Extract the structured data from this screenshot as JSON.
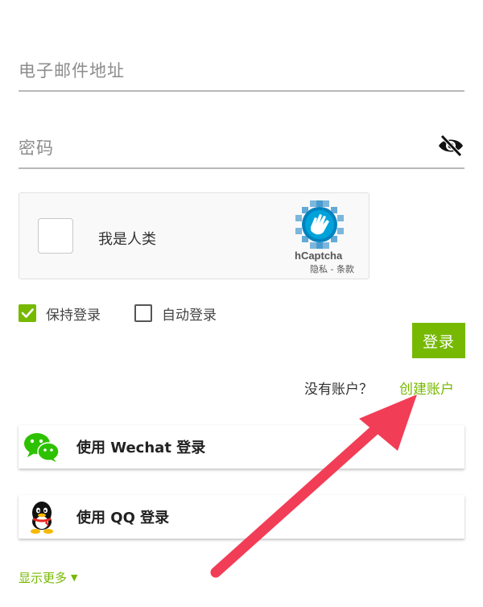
{
  "form": {
    "email_placeholder": "电子邮件地址",
    "password_placeholder": "密码",
    "password_toggle_icon": "eye-slash-icon"
  },
  "captcha": {
    "label": "我是人类",
    "brand": "hCaptcha",
    "links": "隐私 - 条款"
  },
  "options": {
    "keep_login": {
      "label": "保持登录",
      "checked": true
    },
    "auto_login": {
      "label": "自动登录",
      "checked": false
    }
  },
  "actions": {
    "login_label": "登录",
    "no_account_text": "没有账户？",
    "create_account_label": "创建账户"
  },
  "social": [
    {
      "label": "使用 Wechat 登录",
      "icon": "wechat-icon"
    },
    {
      "label": "使用 QQ 登录",
      "icon": "qq-icon"
    }
  ],
  "more": {
    "show_more_label": "显示更多",
    "chevron": "▼"
  },
  "colors": {
    "accent": "#76b900",
    "annotation_arrow": "#f23d56"
  }
}
